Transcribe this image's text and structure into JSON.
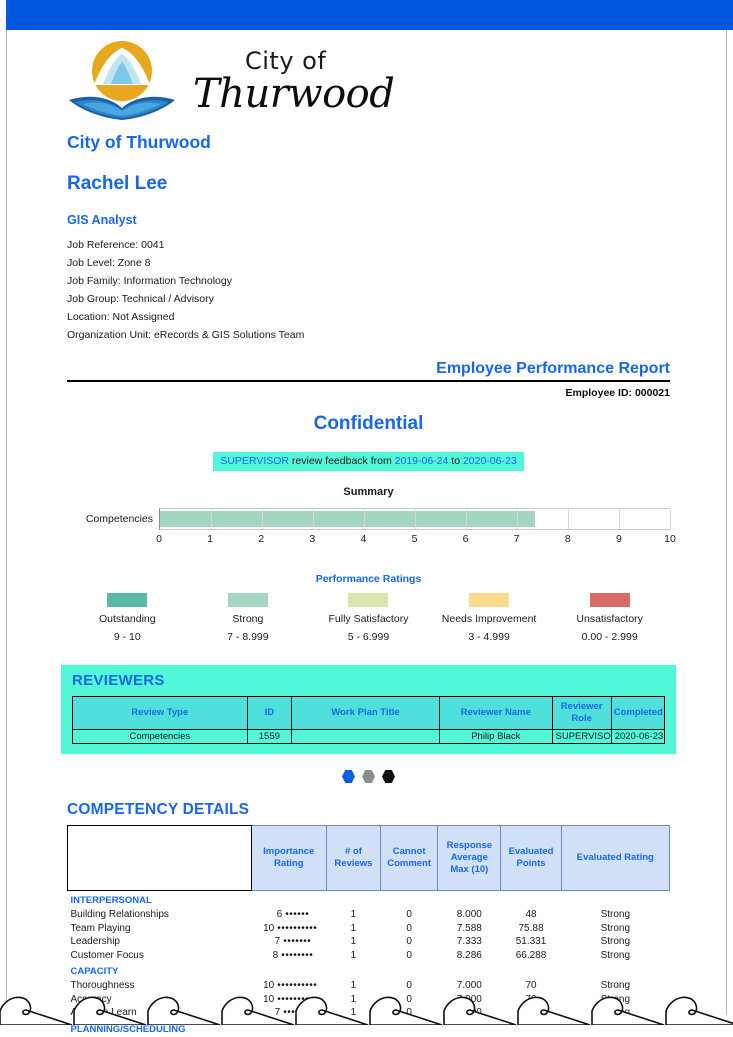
{
  "colors": {
    "top_bar": "#0057E0",
    "accent_blue": "#1967E5",
    "cyan_band": "#52F7DA",
    "table_header_cyan": "#4FE0DC",
    "table_header_blue": "#CFE0F7",
    "bar_green": "#A5D6C1"
  },
  "logo": {
    "city_of": "City of",
    "name": "Thurwood",
    "mark_icon": "sun-mountain-book-logo-icon"
  },
  "org_title": "City of Thurwood",
  "employee": {
    "name": "Rachel Lee",
    "role": "GIS Analyst",
    "fields": [
      "Job Reference: 0041",
      "Job Level: Zone 8",
      "Job Family: Information Technology",
      "Job Group: Technical / Advisory",
      "Location: Not Assigned",
      "Organization Unit: eRecords & GIS Solutions Team"
    ]
  },
  "report": {
    "title": "Employee Performance Report",
    "employee_id": "Employee ID: 000021",
    "confidential": "Confidential",
    "feedback_prefix": "SUPERVISOR",
    "feedback_mid": " review feedback from ",
    "feedback_from": "2019-06-24",
    "feedback_to_word": " to ",
    "feedback_to": "2020-06-23"
  },
  "chart_data": {
    "type": "bar",
    "title": "Summary",
    "orientation": "horizontal",
    "categories": [
      "Competencies"
    ],
    "values": [
      7.35
    ],
    "xlabel": "",
    "ylabel": "",
    "xlim": [
      0,
      10
    ],
    "ticks": [
      0,
      1,
      2,
      3,
      4,
      5,
      6,
      7,
      8,
      9,
      10
    ],
    "grid": true,
    "legend": false,
    "bar_color": "#A5D6C1"
  },
  "ratings_legend": {
    "title": "Performance Ratings",
    "items": [
      {
        "label": "Outstanding",
        "range": "9 - 10",
        "color": "#5CB9A5"
      },
      {
        "label": "Strong",
        "range": "7 - 8.999",
        "color": "#A5D6C1"
      },
      {
        "label": "Fully Satisfactory",
        "range": "5 - 6.999",
        "color": "#D9E8AE"
      },
      {
        "label": "Needs Improvement",
        "range": "3 - 4.999",
        "color": "#FBDC8E"
      },
      {
        "label": "Unsatisfactory",
        "range": "0.00 - 2.999",
        "color": "#D96A6A"
      }
    ]
  },
  "reviewers": {
    "heading": "REVIEWERS",
    "columns": [
      "Review Type",
      "ID",
      "Work Plan Title",
      "Reviewer Name",
      "Reviewer Role",
      "Completed"
    ],
    "rows": [
      {
        "review_type": "Competencies",
        "id": "1559",
        "work_plan_title": "",
        "reviewer_name": "Philip Black",
        "reviewer_role": "SUPERVISOR",
        "completed": "2020-06-23"
      }
    ]
  },
  "page_dots": [
    {
      "name": "page-dot-blue",
      "color": "#0B5FE0"
    },
    {
      "name": "page-dot-gray",
      "color": "#8C8C8C"
    },
    {
      "name": "page-dot-black",
      "color": "#111111"
    }
  ],
  "competency_details": {
    "heading": "COMPETENCY DETAILS",
    "columns": [
      "",
      "Importance Rating",
      "# of Reviews",
      "Cannot Comment",
      "Response Average Max (10)",
      "Evaluated Points",
      "Evaluated Rating"
    ],
    "column_lines": [
      [
        "",
        ""
      ],
      [
        "Importance",
        "Rating"
      ],
      [
        "# of",
        "Reviews"
      ],
      [
        "Cannot",
        "Comment"
      ],
      [
        "Response",
        "Average",
        "Max (10)"
      ],
      [
        "Evaluated",
        "Points"
      ],
      [
        "Evaluated Rating"
      ]
    ],
    "groups": [
      {
        "category": "INTERPERSONAL",
        "rows": [
          {
            "name": "Building Relationships",
            "importance": 6,
            "reviews": "1",
            "cannot_comment": "0",
            "response_average": "8.000",
            "evaluated_points": "48",
            "evaluated_rating": "Strong"
          },
          {
            "name": "Team Playing",
            "importance": 10,
            "reviews": "1",
            "cannot_comment": "0",
            "response_average": "7.588",
            "evaluated_points": "75.88",
            "evaluated_rating": "Strong"
          },
          {
            "name": "Leadership",
            "importance": 7,
            "reviews": "1",
            "cannot_comment": "0",
            "response_average": "7.333",
            "evaluated_points": "51.331",
            "evaluated_rating": "Strong"
          },
          {
            "name": "Customer Focus",
            "importance": 8,
            "reviews": "1",
            "cannot_comment": "0",
            "response_average": "8.286",
            "evaluated_points": "66.288",
            "evaluated_rating": "Strong"
          }
        ]
      },
      {
        "category": "CAPACITY",
        "rows": [
          {
            "name": "Thoroughness",
            "importance": 10,
            "reviews": "1",
            "cannot_comment": "0",
            "response_average": "7.000",
            "evaluated_points": "70",
            "evaluated_rating": "Strong"
          },
          {
            "name": "Accuracy",
            "importance": 10,
            "reviews": "1",
            "cannot_comment": "0",
            "response_average": "7.000",
            "evaluated_points": "70",
            "evaluated_rating": "Strong"
          },
          {
            "name": "Ability to Learn",
            "importance": 7,
            "reviews": "1",
            "cannot_comment": "0",
            "response_average": "7.500",
            "evaluated_points": "52.5",
            "evaluated_rating": "Strong"
          }
        ]
      },
      {
        "category": "PLANNING/SCHEDULING",
        "rows": []
      }
    ]
  }
}
